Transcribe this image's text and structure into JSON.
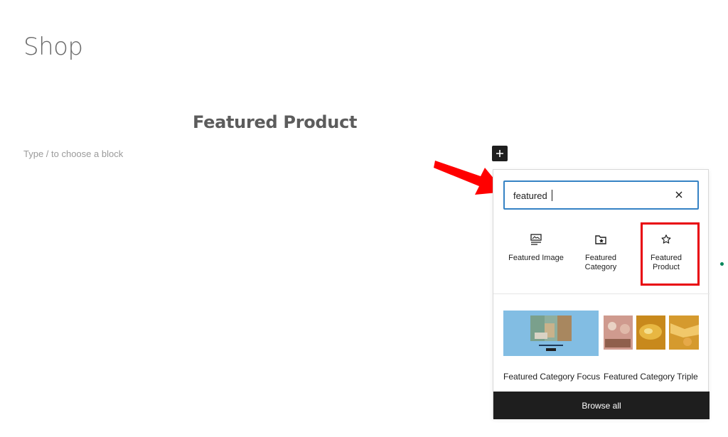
{
  "page": {
    "title": "Shop",
    "block_heading": "Featured Product",
    "placeholder": "Type / to choose a block"
  },
  "inserter": {
    "toggle_icon": "plus-icon",
    "search": {
      "value": "featured",
      "clear_icon": "close-icon"
    },
    "blocks": [
      {
        "label": "Featured Image",
        "icon": "featured-image-icon"
      },
      {
        "label": "Featured Category",
        "icon": "folder-star-icon"
      },
      {
        "label": "Featured Product",
        "icon": "star-icon"
      }
    ],
    "patterns": [
      {
        "label": "Featured Category Focus"
      },
      {
        "label": "Featured Category Triple"
      }
    ],
    "browse_all_label": "Browse all"
  },
  "annotations": {
    "arrow_color": "#ff0000",
    "highlight_color": "#e8000b"
  },
  "colors": {
    "accent": "#3582c4",
    "dark": "#1e1e1e",
    "pattern_bg": "#82bde3"
  }
}
